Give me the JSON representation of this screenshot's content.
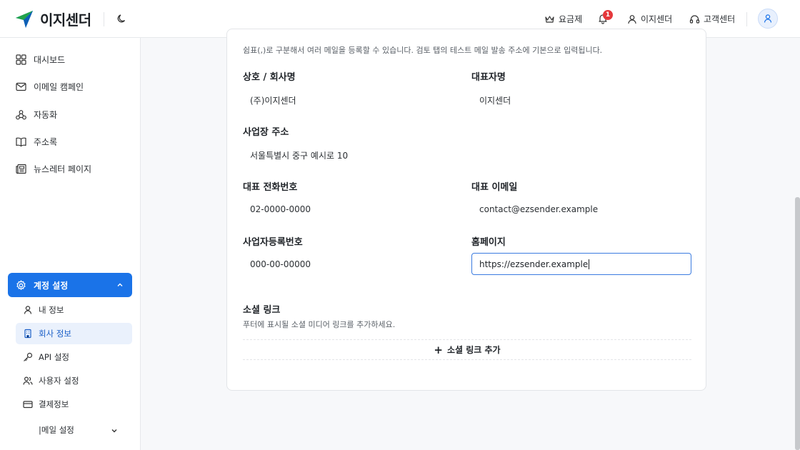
{
  "header": {
    "logo_text": "이지센더",
    "pricing": "요금제",
    "notification_count": "1",
    "user_name": "이지센더",
    "support": "고객센터"
  },
  "sidebar": {
    "items": [
      {
        "label": "대시보드",
        "icon": "dashboard-icon"
      },
      {
        "label": "이메일 캠페인",
        "icon": "mail-icon"
      },
      {
        "label": "자동화",
        "icon": "automation-icon"
      },
      {
        "label": "주소록",
        "icon": "book-icon"
      },
      {
        "label": "뉴스레터 페이지",
        "icon": "newspaper-icon"
      }
    ],
    "active_section": "계정 설정",
    "sub_items": [
      {
        "label": "내 정보"
      },
      {
        "label": "회사 정보"
      },
      {
        "label": "API 설정"
      },
      {
        "label": "사용자 설정"
      },
      {
        "label": "결제정보"
      },
      {
        "label": "|메일 설정"
      }
    ]
  },
  "form": {
    "description": "쉼표(,)로 구분해서 여러 메일을 등록할 수 있습니다. 검토 탭의 테스트 메일 발송 주소에 기본으로 입력됩니다.",
    "company_name_label": "상호 / 회사명",
    "company_name": "(주)이지센더",
    "ceo_label": "대표자명",
    "ceo": "이지센더",
    "address_label": "사업장 주소",
    "address": "서울특별시 중구 예시로 10",
    "phone_label": "대표 전화번호",
    "phone": "02-0000-0000",
    "email_label": "대표 이메일",
    "email": "contact@ezsender.example",
    "biz_no_label": "사업자등록번호",
    "biz_no": "000-00-00000",
    "homepage_label": "홈페이지",
    "homepage": "https://ezsender.example",
    "social_label": "소셜 링크",
    "social_desc": "푸터에 표시될 소셜 미디어 링크를 추가하세요.",
    "add_social": "소셜 링크 추가"
  },
  "colors": {
    "accent": "#1a73e8",
    "badge": "#e5383b"
  }
}
